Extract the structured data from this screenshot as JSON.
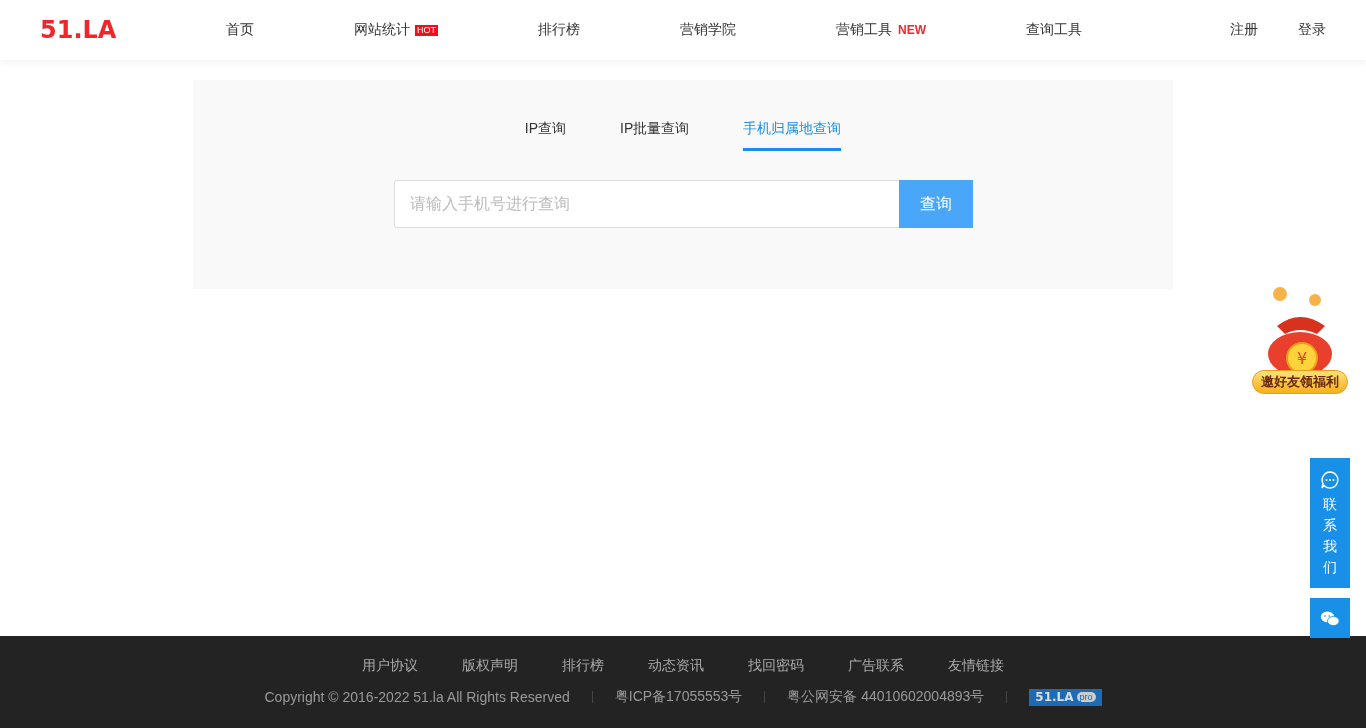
{
  "header": {
    "logo": "51.LA",
    "nav": [
      {
        "label": "首页"
      },
      {
        "label": "网站统计",
        "badge": {
          "kind": "filled",
          "text": "HOT"
        }
      },
      {
        "label": "排行榜"
      },
      {
        "label": "营销学院"
      },
      {
        "label": "营销工具",
        "badge": {
          "kind": "plain",
          "text": "NEW"
        }
      },
      {
        "label": "查询工具"
      }
    ],
    "account": [
      "注册",
      "登录"
    ]
  },
  "query": {
    "tabs": [
      {
        "label": "IP查询",
        "selected": false
      },
      {
        "label": "IP批量查询",
        "selected": false
      },
      {
        "label": "手机归属地查询",
        "selected": true
      }
    ],
    "search": {
      "placeholder": "请输入手机号进行查询",
      "button": "查询"
    }
  },
  "promo": {
    "coin": "¥",
    "label": "邀好友领福利"
  },
  "contact": {
    "label": "联系我们"
  },
  "footer": {
    "links": [
      "用户协议",
      "版权声明",
      "排行榜",
      "动态资讯",
      "找回密码",
      "广告联系",
      "友情链接"
    ],
    "copyright": "Copyright © 2016-2022 51.la All Rights Reserved",
    "icp": "粤ICP备17055553号",
    "police": "粤公网安备 44010602004893号",
    "badge": {
      "logo": "51.LA",
      "suffix": "pro"
    }
  }
}
